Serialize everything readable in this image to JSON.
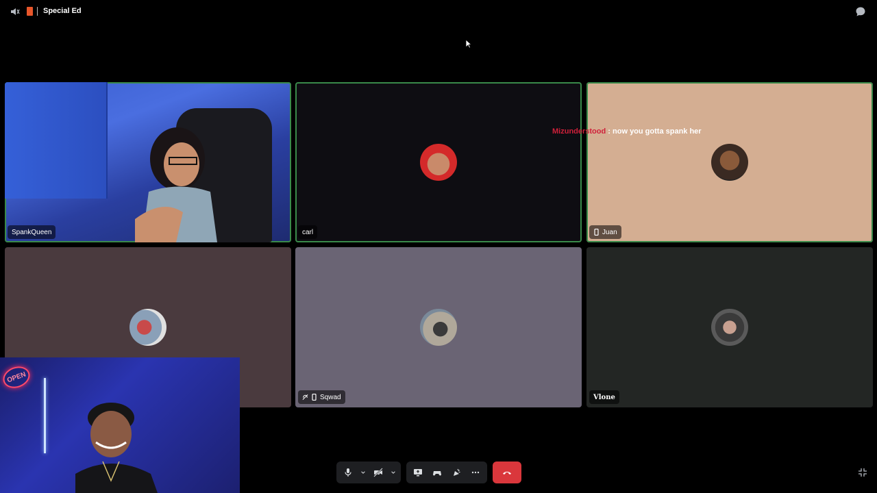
{
  "header": {
    "channel_title": "Special Ed",
    "volume_icon": "volume-muted-icon",
    "stage_icon": "stage-channel-icon",
    "chat_icon": "chat-bubble-icon"
  },
  "tiles": [
    {
      "name": "SpankQueen",
      "speaking": true
    },
    {
      "name": "carl",
      "speaking": true
    },
    {
      "name": "Juan",
      "speaking": true,
      "device_icon": "mobile-icon"
    },
    {
      "name": "",
      "speaking": false
    },
    {
      "name": "Sqwad",
      "speaking": false,
      "status_icons": [
        "deafened-icon",
        "mobile-icon"
      ]
    },
    {
      "name": "Vlone",
      "speaking": false
    }
  ],
  "chat_overlay": {
    "user": "Mizunderstood",
    "separator": ":",
    "message": "now you gotta spank her"
  },
  "webcam": {
    "sign_text": "OPEN"
  },
  "controls": {
    "icons": [
      "microphone-icon",
      "camera-off-icon",
      "screen-share-icon",
      "activity-icon",
      "soundboard-icon",
      "more-icon",
      "hang-up-icon"
    ]
  },
  "colors": {
    "speaking_border": "#3a8a4a",
    "hangup": "#da373c",
    "chat_user": "#d0203a"
  }
}
